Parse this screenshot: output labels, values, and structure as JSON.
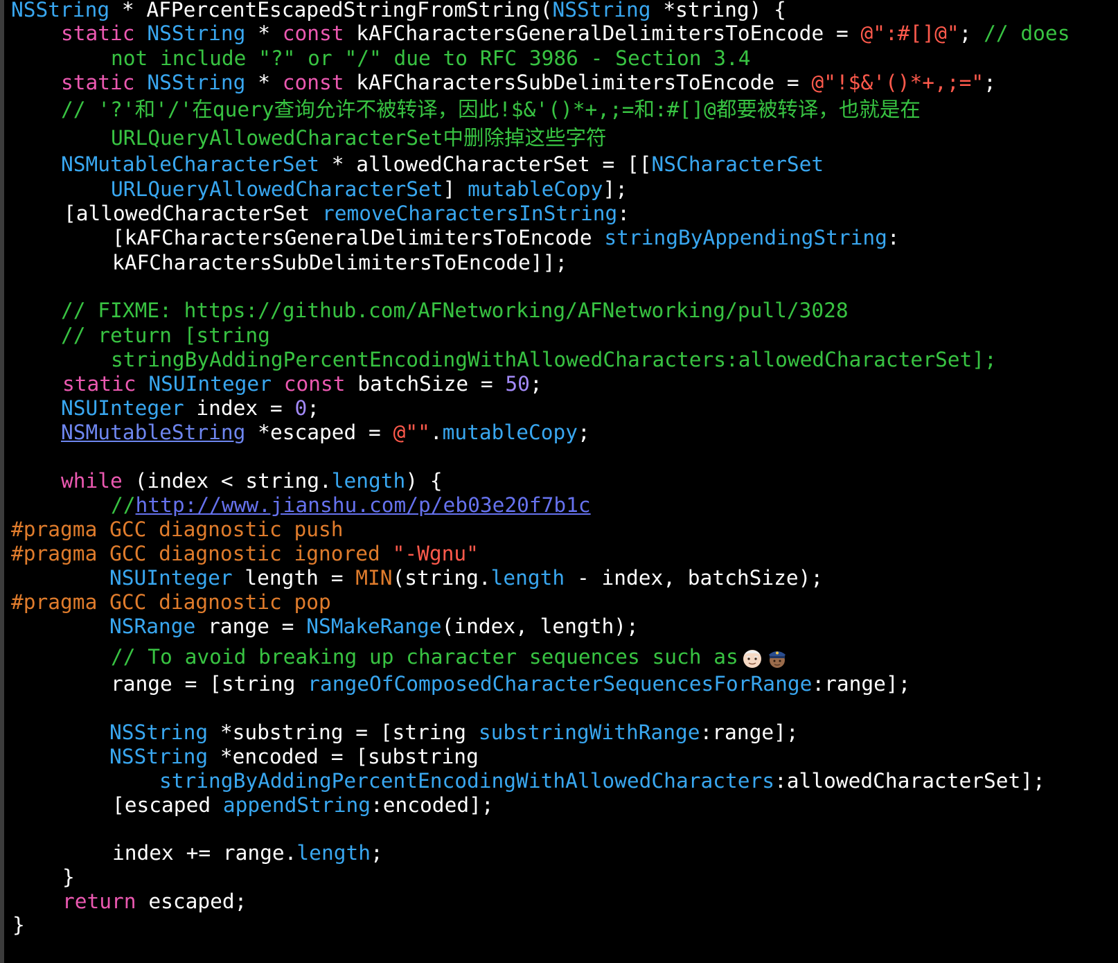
{
  "editor": {
    "colors": {
      "background": "#000000",
      "keyword": "#eb59b1",
      "type": "#39a7f0",
      "string": "#ff5a4c",
      "number": "#a38af8",
      "comment": "#38c342",
      "preprocessor": "#e07c2c",
      "link": "#6672ee"
    },
    "lines": {
      "l1": {
        "t1": "NSString",
        "t2": " * AFPercentEscapedStringFromString(",
        "t3": "NSString",
        "t4": " *string) {"
      },
      "l2": {
        "t1": "static",
        "t2": " ",
        "t3": "NSString",
        "t4": " * ",
        "t5": "const",
        "t6": " kAFCharactersGeneralDelimitersToEncode = ",
        "t7": "@\":#[]@\"",
        "t8": "; ",
        "t9": "// does"
      },
      "l3": {
        "t1": "not include \"?\" or \"/\" due to RFC 3986 - Section 3.4"
      },
      "l4": {
        "t1": "static",
        "t2": " ",
        "t3": "NSString",
        "t4": " * ",
        "t5": "const",
        "t6": " kAFCharactersSubDelimitersToEncode = ",
        "t7": "@\"!$&'()*+,;=\"",
        "t8": ";"
      },
      "l5": {
        "t1": "// '?'和'/'在query查询允许不被转译，因此!$&'()*+,;=和:#[]@都要被转译，也就是在"
      },
      "l6": {
        "t1": "URLQueryAllowedCharacterSet中删除掉这些字符"
      },
      "l7": {
        "t1": "NSMutableCharacterSet",
        "t2": " * allowedCharacterSet = [[",
        "t3": "NSCharacterSet"
      },
      "l8": {
        "t1": "URLQueryAllowedCharacterSet",
        "t2": "] ",
        "t3": "mutableCopy",
        "t4": "];"
      },
      "l9": {
        "t1": "[allowedCharacterSet ",
        "t2": "removeCharactersInString",
        "t3": ":"
      },
      "l10": {
        "t1": "[kAFCharactersGeneralDelimitersToEncode ",
        "t2": "stringByAppendingString",
        "t3": ":"
      },
      "l11": {
        "t1": "kAFCharactersSubDelimitersToEncode]];"
      },
      "l12": {
        "t1": "// FIXME: https://github.com/AFNetworking/AFNetworking/pull/3028"
      },
      "l13": {
        "t1": "// return [string"
      },
      "l14": {
        "t1": "stringByAddingPercentEncodingWithAllowedCharacters:allowedCharacterSet];"
      },
      "l15": {
        "t1": "static",
        "t2": " ",
        "t3": "NSUInteger",
        "t4": " ",
        "t5": "const",
        "t6": " batchSize = ",
        "t7": "50",
        "t8": ";"
      },
      "l16": {
        "t1": "NSUInteger",
        "t2": " index = ",
        "t3": "0",
        "t4": ";"
      },
      "l17": {
        "t1": "NSMutableString",
        "t2": " *escaped = ",
        "t3": "@\"\"",
        "t4": ".",
        "t5": "mutableCopy",
        "t6": ";"
      },
      "l18": {
        "t1": "while",
        "t2": " (index < string.",
        "t3": "length",
        "t4": ") {"
      },
      "l19": {
        "t1": "//",
        "t2": "http://www.jianshu.com/p/eb03e20f7b1c"
      },
      "l20": {
        "t1": "#pragma",
        "t2": " GCC diagnostic push"
      },
      "l21": {
        "t1": "#pragma",
        "t2": " GCC diagnostic ignored ",
        "t3": "\"-Wgnu\""
      },
      "l22": {
        "t1": "NSUInteger",
        "t2": " length = ",
        "t3": "MIN",
        "t4": "(string.",
        "t5": "length",
        "t6": " - index, batchSize);"
      },
      "l23": {
        "t1": "#pragma",
        "t2": " GCC diagnostic pop"
      },
      "l24": {
        "t1": "NSRange",
        "t2": " range = ",
        "t3": "NSMakeRange",
        "t4": "(index, length);"
      },
      "l25": {
        "t1": "// To avoid breaking up character sequences such as",
        "emoji1": "older-man-emoji",
        "emoji2": "police-officer-emoji"
      },
      "l26": {
        "t1": "range = [string ",
        "t2": "rangeOfComposedCharacterSequencesForRange",
        "t3": ":range];"
      },
      "l27": {
        "t1": "NSString",
        "t2": " *substring = [string ",
        "t3": "substringWithRange",
        "t4": ":range];"
      },
      "l28": {
        "t1": "NSString",
        "t2": " *encoded = [substring"
      },
      "l29": {
        "t1": "stringByAddingPercentEncodingWithAllowedCharacters",
        "t2": ":allowedCharacterSet];"
      },
      "l30": {
        "t1": "[escaped ",
        "t2": "appendString",
        "t3": ":encoded];"
      },
      "l31": {
        "t1": "index += range.",
        "t2": "length",
        "t3": ";"
      },
      "l32": {
        "t1": "}"
      },
      "l33": {
        "t1": "return",
        "t2": " escaped;"
      },
      "l34": {
        "t1": "}"
      }
    }
  }
}
